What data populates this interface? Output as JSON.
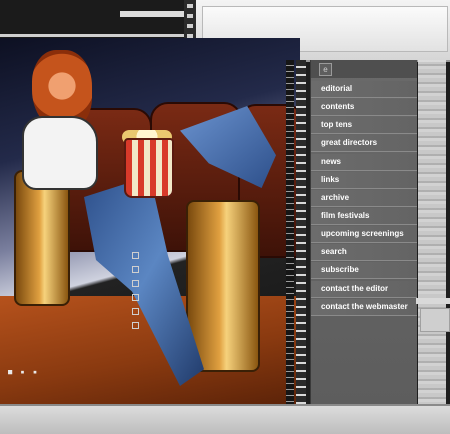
{
  "nav": {
    "items": [
      {
        "label": "editorial"
      },
      {
        "label": "contents"
      },
      {
        "label": "top tens"
      },
      {
        "label": "great directors"
      },
      {
        "label": "news"
      },
      {
        "label": "links"
      },
      {
        "label": "archive"
      },
      {
        "label": "film festivals"
      },
      {
        "label": "upcoming screenings"
      },
      {
        "label": "search"
      },
      {
        "label": "subscribe"
      },
      {
        "label": "contact the editor"
      },
      {
        "label": "contact the webmaster"
      }
    ]
  },
  "colors": {
    "nav_bg": "#666666",
    "nav_text": "#ffffff",
    "chrome_light": "#e0e0e0",
    "floor": "#b6521c",
    "jeans": "#4a72b0"
  },
  "illustration": {
    "icon_names": [
      "popcorn-icon",
      "theater-seat-icon"
    ]
  }
}
